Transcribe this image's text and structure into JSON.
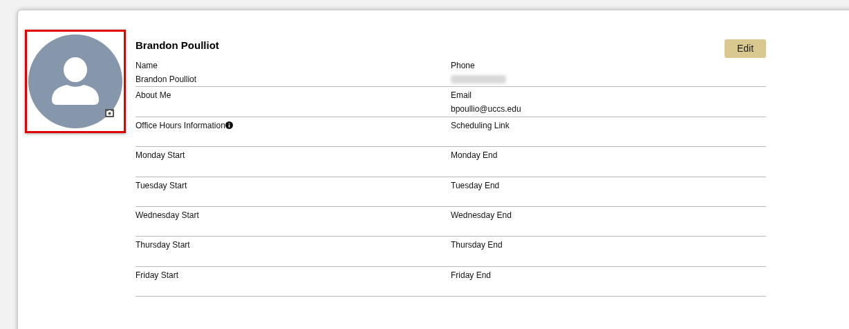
{
  "avatar": {
    "highlighted": true
  },
  "profile": {
    "heading": "Brandon Poulliot",
    "edit_button": "Edit"
  },
  "rows": [
    [
      {
        "label": "Name",
        "value": "Brandon Poulliot",
        "info_icon": false
      },
      {
        "label": "Phone",
        "redacted": true,
        "info_icon": false
      }
    ],
    [
      {
        "label": "About Me",
        "info_icon": false
      },
      {
        "label": "Email",
        "value": "bpoullio@uccs.edu",
        "info_icon": false
      }
    ],
    [
      {
        "label": "Office Hours Information",
        "info_icon": true
      },
      {
        "label": "Scheduling Link",
        "info_icon": false
      }
    ],
    [
      {
        "label": "Monday Start",
        "info_icon": false
      },
      {
        "label": "Monday End",
        "info_icon": false
      }
    ],
    [
      {
        "label": "Tuesday Start",
        "info_icon": false
      },
      {
        "label": "Tuesday End",
        "info_icon": false
      }
    ],
    [
      {
        "label": "Wednesday Start",
        "info_icon": false
      },
      {
        "label": "Wednesday End",
        "info_icon": false
      }
    ],
    [
      {
        "label": "Thursday Start",
        "info_icon": false
      },
      {
        "label": "Thursday End",
        "info_icon": false
      }
    ],
    [
      {
        "label": "Friday Start",
        "info_icon": false
      },
      {
        "label": "Friday End",
        "info_icon": false
      }
    ]
  ]
}
